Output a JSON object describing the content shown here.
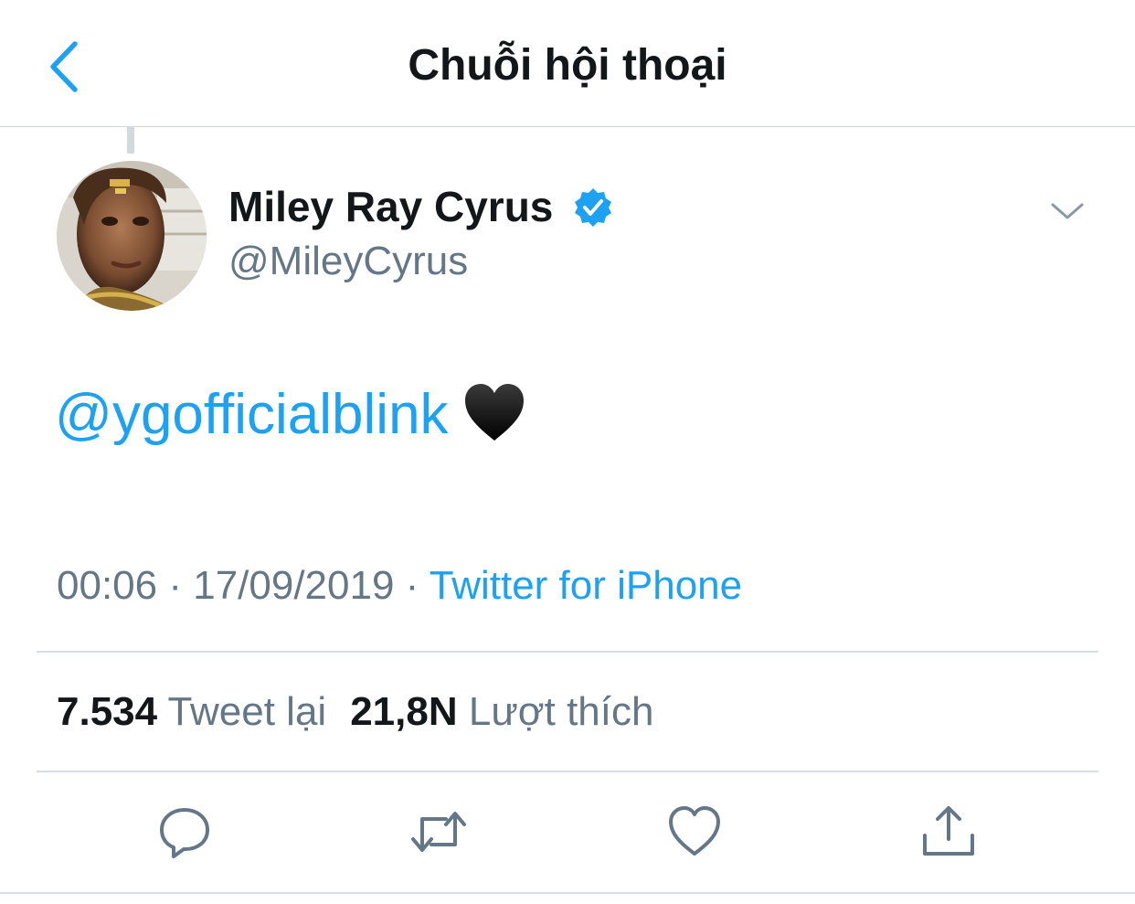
{
  "header": {
    "title": "Chuỗi hội thoại",
    "back_icon": "chevron-left-icon"
  },
  "tweet": {
    "author": {
      "name": "Miley Ray Cyrus",
      "handle": "@MileyCyrus",
      "verified": true
    },
    "text": {
      "mention": "@ygofficialblink",
      "emoji": "black-heart"
    },
    "meta": {
      "time": "00:06",
      "separator1": " · ",
      "date": "17/09/2019",
      "separator2": " · ",
      "source": "Twitter for iPhone"
    },
    "stats": {
      "retweets_count": "7.534",
      "retweets_label": "Tweet lại",
      "likes_count": "21,8N",
      "likes_label": "Lượt thích"
    }
  },
  "actions": [
    "reply-icon",
    "retweet-icon",
    "like-icon",
    "share-icon"
  ],
  "colors": {
    "accent": "#1da1f2",
    "text_primary": "#14171a",
    "text_secondary": "#657786",
    "divider": "#d6dde3"
  }
}
